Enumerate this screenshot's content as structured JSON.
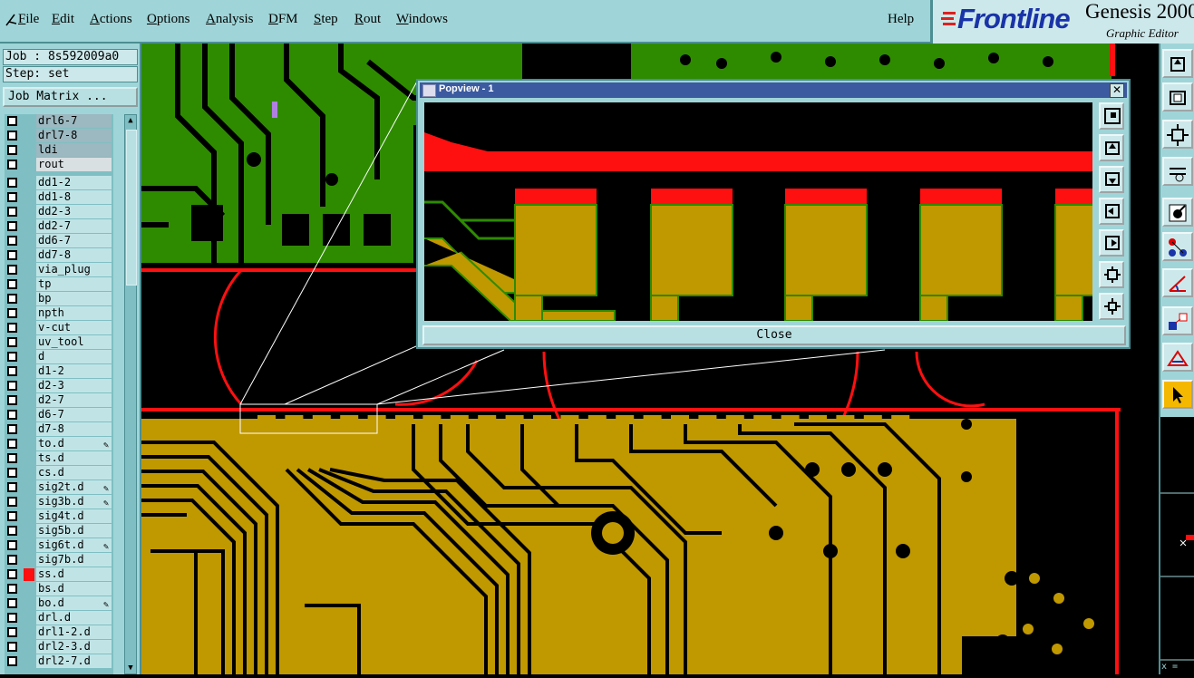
{
  "menubar": {
    "items": [
      {
        "label": "File",
        "underline": "F"
      },
      {
        "label": "Edit",
        "underline": "E"
      },
      {
        "label": "Actions",
        "underline": "A"
      },
      {
        "label": "Options",
        "underline": "O"
      },
      {
        "label": "Analysis",
        "underline": "A"
      },
      {
        "label": "DFM",
        "underline": "D"
      },
      {
        "label": "Step",
        "underline": "S"
      },
      {
        "label": "Rout",
        "underline": "R"
      },
      {
        "label": "Windows",
        "underline": "W"
      }
    ],
    "help": "Help"
  },
  "logo": {
    "brand": "Frontline",
    "app": "Genesis 2000",
    "subtitle": "Graphic Editor"
  },
  "job": {
    "job_line": "Job : 8s592009a0",
    "step_line": "Step: set",
    "matrix_button": "Job Matrix ..."
  },
  "layers": [
    {
      "name": "drl6-7",
      "style": "grey",
      "edit": false
    },
    {
      "name": "drl7-8",
      "style": "grey",
      "edit": false
    },
    {
      "name": "ldi",
      "style": "grey",
      "edit": false
    },
    {
      "name": "rout",
      "style": "lt",
      "edit": false
    },
    {
      "name": "dd1-2",
      "style": "",
      "edit": false
    },
    {
      "name": "dd1-8",
      "style": "",
      "edit": false
    },
    {
      "name": "dd2-3",
      "style": "",
      "edit": false
    },
    {
      "name": "dd2-7",
      "style": "",
      "edit": false
    },
    {
      "name": "dd6-7",
      "style": "",
      "edit": false
    },
    {
      "name": "dd7-8",
      "style": "",
      "edit": false
    },
    {
      "name": "via_plug",
      "style": "",
      "edit": false
    },
    {
      "name": "tp",
      "style": "",
      "edit": false
    },
    {
      "name": "bp",
      "style": "",
      "edit": false
    },
    {
      "name": "npth",
      "style": "",
      "edit": false
    },
    {
      "name": "v-cut",
      "style": "",
      "edit": false
    },
    {
      "name": "uv_tool",
      "style": "",
      "edit": false
    },
    {
      "name": "d",
      "style": "",
      "edit": false
    },
    {
      "name": "d1-2",
      "style": "",
      "edit": false
    },
    {
      "name": "d2-3",
      "style": "",
      "edit": false
    },
    {
      "name": "d2-7",
      "style": "",
      "edit": false
    },
    {
      "name": "d6-7",
      "style": "",
      "edit": false
    },
    {
      "name": "d7-8",
      "style": "",
      "edit": false
    },
    {
      "name": "to.d",
      "style": "",
      "edit": true
    },
    {
      "name": "ts.d",
      "style": "",
      "edit": false
    },
    {
      "name": "cs.d",
      "style": "",
      "edit": false
    },
    {
      "name": "sig2t.d",
      "style": "",
      "edit": true
    },
    {
      "name": "sig3b.d",
      "style": "",
      "edit": true
    },
    {
      "name": "sig4t.d",
      "style": "",
      "edit": false
    },
    {
      "name": "sig5b.d",
      "style": "",
      "edit": false
    },
    {
      "name": "sig6t.d",
      "style": "",
      "edit": true
    },
    {
      "name": "sig7b.d",
      "style": "",
      "edit": false
    },
    {
      "name": "ss.d",
      "style": "",
      "edit": false,
      "marker": "#ff1010"
    },
    {
      "name": "bs.d",
      "style": "",
      "edit": false
    },
    {
      "name": "bo.d",
      "style": "",
      "edit": true
    },
    {
      "name": "drl.d",
      "style": "",
      "edit": false
    },
    {
      "name": "drl1-2.d",
      "style": "",
      "edit": false
    },
    {
      "name": "drl2-3.d",
      "style": "",
      "edit": false
    },
    {
      "name": "drl2-7.d",
      "style": "",
      "edit": false
    }
  ],
  "right_toolbar": [
    {
      "icon": "zoom-home-icon"
    },
    {
      "icon": "zoom-in-icon"
    },
    {
      "icon": "zoom-fit-icon"
    },
    {
      "icon": "measure-icon"
    },
    {
      "icon": "snap-icon"
    },
    {
      "icon": "connect-icon"
    },
    {
      "icon": "angle-icon"
    },
    {
      "icon": "select-move-icon"
    },
    {
      "icon": "triangle-icon"
    },
    {
      "icon": "pointer-icon",
      "active": true
    }
  ],
  "popview": {
    "title": "Popview - 1",
    "close_label": "Close",
    "tools": [
      "zoom-box-icon",
      "pan-up-icon",
      "pan-down-icon",
      "pan-left-icon",
      "pan-right-icon",
      "zoom-out-icon",
      "zoom-reset-icon"
    ]
  },
  "coord_prefix": "x =",
  "colors": {
    "panel": "#9fd5d8",
    "copper": "#c09800",
    "green_layer": "#2e8b00",
    "outline": "#ff1010",
    "brand": "#1933a8",
    "active_tool": "#f5b800"
  }
}
